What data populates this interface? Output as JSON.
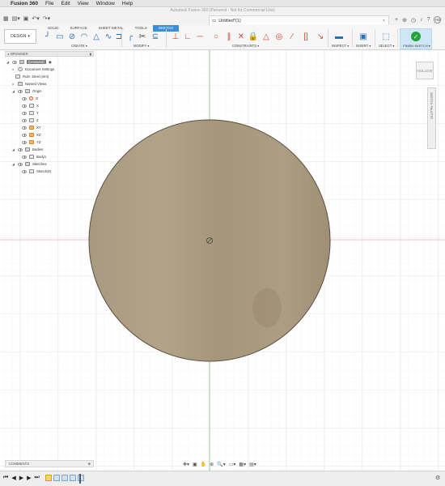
{
  "menubar": {
    "apple_icon": "apple-icon",
    "app_name": "Fusion 360",
    "items": [
      "File",
      "Edit",
      "View",
      "Window",
      "Help"
    ]
  },
  "window": {
    "title": "Autodesk Fusion 360 (Personal - Not for Commercial Use)",
    "doc_tab_title": "Untitled*(1)",
    "doc_tab_close": "×",
    "user_initials": "HS"
  },
  "ribbon": {
    "workspace_label": "DESIGN",
    "tabs": [
      "SOLID",
      "SURFACE",
      "SHEET METAL",
      "TOOLS",
      "SKETCH"
    ],
    "active_tab": "SKETCH",
    "groups": {
      "create": "CREATE ▾",
      "modify": "MODIFY ▾",
      "constraints": "CONSTRAINTS ▾",
      "inspect": "INSPECT ▾",
      "insert": "INSERT ▾",
      "select": "SELECT ▾"
    },
    "finish_sketch_label": "FINISH SKETCH ▾",
    "finish_color": "#1fa33a",
    "active_tab_color": "#3b8fd9"
  },
  "browser": {
    "header": "BROWSER",
    "items": [
      {
        "label": "(Unsaved)",
        "icon": "unsaved-icon",
        "expanded": true
      },
      {
        "label": "Document Settings",
        "icon": "gear-icon",
        "expanded": false
      },
      {
        "label": "Rule: Steel (mm)",
        "icon": "rule-icon",
        "expanded": null
      },
      {
        "label": "Named Views",
        "icon": "folder-icon",
        "expanded": false
      },
      {
        "label": "Origin",
        "icon": "folder-icon",
        "expanded": true
      },
      {
        "label": "O",
        "icon": "origin-icon"
      },
      {
        "label": "X",
        "icon": "axis-icon"
      },
      {
        "label": "Y",
        "icon": "axis-icon"
      },
      {
        "label": "Z",
        "icon": "axis-icon"
      },
      {
        "label": "XY",
        "icon": "plane-icon"
      },
      {
        "label": "XZ",
        "icon": "plane-icon"
      },
      {
        "label": "YZ",
        "icon": "plane-icon"
      },
      {
        "label": "Bodies",
        "icon": "folder-icon",
        "expanded": true
      },
      {
        "label": "Body1",
        "icon": "body-icon"
      },
      {
        "label": "Sketches",
        "icon": "folder-icon",
        "expanded": true
      },
      {
        "label": "Sketch20",
        "icon": "sketch-icon"
      }
    ]
  },
  "viewport": {
    "viewcube_label": "HOLLIDE",
    "sketch_palette_label": "SKETCH PALETTE",
    "disk_color": "#a8977a",
    "axis_green": "#7cc47c",
    "axis_red": "#e09090"
  },
  "comments": {
    "label": "COMMENTS"
  },
  "timeline": {
    "controls": [
      "⏮",
      "◀",
      "▶",
      "▶",
      "⏭"
    ],
    "item_count": 5
  }
}
